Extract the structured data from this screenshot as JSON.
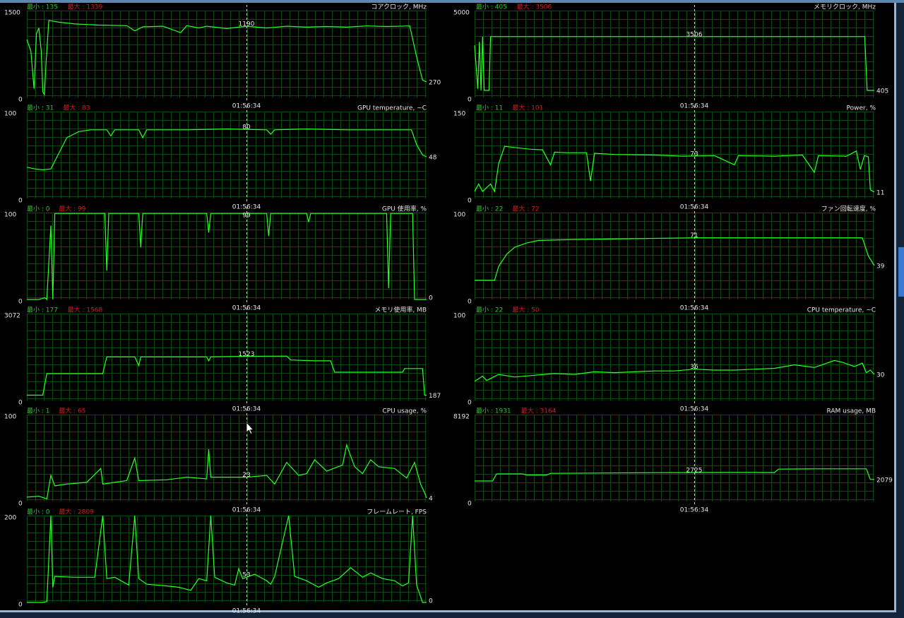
{
  "cursor_time": "01:56:34",
  "legend_min_prefix": "最小 : ",
  "legend_max_prefix": "最大 : ",
  "colors": {
    "min_text": "#2ec32e",
    "max_text": "#cc1f1f",
    "trace": "#2aff2a",
    "grid": "#0e4a0e",
    "cursor": "#e3e35a",
    "background": "#000000"
  },
  "graphs": [
    {
      "id": "core-clock",
      "title": "コアクロック, MHz",
      "min": "135",
      "max": "1339",
      "ymin": 0,
      "ymax": 1500,
      "top_label": "1500",
      "bottom_label": "0",
      "cursor_value": "1190",
      "end_value": "270",
      "points": [
        [
          0.0,
          1000
        ],
        [
          0.01,
          800
        ],
        [
          0.018,
          150
        ],
        [
          0.024,
          1100
        ],
        [
          0.03,
          1200
        ],
        [
          0.036,
          800
        ],
        [
          0.04,
          100
        ],
        [
          0.044,
          50
        ],
        [
          0.048,
          600
        ],
        [
          0.055,
          1330
        ],
        [
          0.08,
          1300
        ],
        [
          0.12,
          1270
        ],
        [
          0.18,
          1250
        ],
        [
          0.25,
          1240
        ],
        [
          0.27,
          1150
        ],
        [
          0.29,
          1220
        ],
        [
          0.34,
          1230
        ],
        [
          0.385,
          1120
        ],
        [
          0.4,
          1240
        ],
        [
          0.43,
          1200
        ],
        [
          0.45,
          1230
        ],
        [
          0.5,
          1190
        ],
        [
          0.55,
          1230
        ],
        [
          0.6,
          1200
        ],
        [
          0.65,
          1230
        ],
        [
          0.7,
          1215
        ],
        [
          0.75,
          1225
        ],
        [
          0.8,
          1215
        ],
        [
          0.85,
          1235
        ],
        [
          0.9,
          1225
        ],
        [
          0.958,
          1235
        ],
        [
          0.975,
          700
        ],
        [
          0.99,
          300
        ],
        [
          1.0,
          270
        ]
      ]
    },
    {
      "id": "memory-clock",
      "title": "メモリクロック, MHz",
      "min": "405",
      "max": "3506",
      "ymin": 0,
      "ymax": 5000,
      "top_label": "5000",
      "bottom_label": "0",
      "cursor_value": "3506",
      "end_value": "405",
      "points": [
        [
          0.0,
          3000
        ],
        [
          0.008,
          500
        ],
        [
          0.012,
          3200
        ],
        [
          0.016,
          400
        ],
        [
          0.02,
          3500
        ],
        [
          0.024,
          405
        ],
        [
          0.036,
          405
        ],
        [
          0.04,
          3506
        ],
        [
          0.976,
          3506
        ],
        [
          0.982,
          405
        ],
        [
          1.0,
          405
        ]
      ]
    },
    {
      "id": "gpu-temperature",
      "title": "GPU temperature, ~C",
      "min": "31",
      "max": "83",
      "ymin": 0,
      "ymax": 100,
      "top_label": "100",
      "bottom_label": "0",
      "cursor_value": "80",
      "end_value": "48",
      "points": [
        [
          0.0,
          36
        ],
        [
          0.02,
          34
        ],
        [
          0.04,
          33
        ],
        [
          0.06,
          34
        ],
        [
          0.08,
          52
        ],
        [
          0.1,
          70
        ],
        [
          0.13,
          77
        ],
        [
          0.16,
          79
        ],
        [
          0.2,
          79
        ],
        [
          0.21,
          72
        ],
        [
          0.22,
          79
        ],
        [
          0.28,
          79
        ],
        [
          0.29,
          70
        ],
        [
          0.3,
          79
        ],
        [
          0.4,
          79
        ],
        [
          0.5,
          80
        ],
        [
          0.6,
          79
        ],
        [
          0.61,
          74
        ],
        [
          0.62,
          79
        ],
        [
          0.7,
          80
        ],
        [
          0.8,
          79
        ],
        [
          0.9,
          79
        ],
        [
          0.962,
          79
        ],
        [
          0.975,
          62
        ],
        [
          0.99,
          50
        ],
        [
          1.0,
          48
        ]
      ]
    },
    {
      "id": "power",
      "title": "Power, %",
      "min": "11",
      "max": "101",
      "ymin": 0,
      "ymax": 150,
      "top_label": "150",
      "bottom_label": "0",
      "cursor_value": "73",
      "end_value": "11",
      "points": [
        [
          0.0,
          12
        ],
        [
          0.01,
          25
        ],
        [
          0.02,
          12
        ],
        [
          0.04,
          25
        ],
        [
          0.05,
          12
        ],
        [
          0.06,
          60
        ],
        [
          0.075,
          90
        ],
        [
          0.1,
          88
        ],
        [
          0.14,
          85
        ],
        [
          0.17,
          84
        ],
        [
          0.19,
          58
        ],
        [
          0.2,
          80
        ],
        [
          0.23,
          79
        ],
        [
          0.28,
          79
        ],
        [
          0.29,
          30
        ],
        [
          0.3,
          78
        ],
        [
          0.35,
          76
        ],
        [
          0.45,
          75
        ],
        [
          0.52,
          73
        ],
        [
          0.6,
          74
        ],
        [
          0.65,
          58
        ],
        [
          0.66,
          74
        ],
        [
          0.75,
          73
        ],
        [
          0.82,
          75
        ],
        [
          0.85,
          45
        ],
        [
          0.86,
          74
        ],
        [
          0.93,
          73
        ],
        [
          0.955,
          82
        ],
        [
          0.965,
          50
        ],
        [
          0.975,
          74
        ],
        [
          0.985,
          72
        ],
        [
          0.99,
          15
        ],
        [
          1.0,
          11
        ]
      ]
    },
    {
      "id": "gpu-usage",
      "title": "GPU 使用率, %",
      "min": "0",
      "max": "99",
      "ymin": 0,
      "ymax": 100,
      "top_label": "100",
      "bottom_label": "0",
      "cursor_value": "99",
      "end_value": "0",
      "points": [
        [
          0.0,
          0
        ],
        [
          0.03,
          0
        ],
        [
          0.045,
          2
        ],
        [
          0.05,
          0
        ],
        [
          0.06,
          85
        ],
        [
          0.065,
          0
        ],
        [
          0.07,
          99
        ],
        [
          0.195,
          99
        ],
        [
          0.2,
          33
        ],
        [
          0.205,
          99
        ],
        [
          0.28,
          99
        ],
        [
          0.285,
          60
        ],
        [
          0.29,
          99
        ],
        [
          0.45,
          99
        ],
        [
          0.455,
          77
        ],
        [
          0.46,
          99
        ],
        [
          0.6,
          99
        ],
        [
          0.605,
          73
        ],
        [
          0.61,
          99
        ],
        [
          0.7,
          99
        ],
        [
          0.705,
          89
        ],
        [
          0.71,
          99
        ],
        [
          0.9,
          99
        ],
        [
          0.905,
          13
        ],
        [
          0.91,
          99
        ],
        [
          0.965,
          99
        ],
        [
          0.97,
          0
        ],
        [
          1.0,
          0
        ]
      ]
    },
    {
      "id": "fan-speed",
      "title": "ファン回転速度, %",
      "min": "22",
      "max": "72",
      "ymin": 0,
      "ymax": 100,
      "top_label": "100",
      "bottom_label": "0",
      "cursor_value": "71",
      "end_value": "39",
      "points": [
        [
          0.0,
          22
        ],
        [
          0.05,
          22
        ],
        [
          0.06,
          38
        ],
        [
          0.08,
          52
        ],
        [
          0.1,
          60
        ],
        [
          0.13,
          65
        ],
        [
          0.16,
          68
        ],
        [
          0.25,
          69
        ],
        [
          0.4,
          70
        ],
        [
          0.55,
          71
        ],
        [
          0.7,
          71
        ],
        [
          0.85,
          71
        ],
        [
          0.97,
          71
        ],
        [
          0.985,
          50
        ],
        [
          1.0,
          39
        ]
      ]
    },
    {
      "id": "memory-usage",
      "title": "メモリ使用率, MB",
      "min": "177",
      "max": "1568",
      "ymin": 0,
      "ymax": 3072,
      "top_label": "3072",
      "bottom_label": "0",
      "cursor_value": "1523",
      "end_value": "187",
      "points": [
        [
          0.0,
          187
        ],
        [
          0.04,
          187
        ],
        [
          0.05,
          950
        ],
        [
          0.19,
          950
        ],
        [
          0.2,
          1540
        ],
        [
          0.27,
          1540
        ],
        [
          0.28,
          1240
        ],
        [
          0.285,
          1540
        ],
        [
          0.45,
          1540
        ],
        [
          0.455,
          1400
        ],
        [
          0.46,
          1540
        ],
        [
          0.55,
          1560
        ],
        [
          0.65,
          1568
        ],
        [
          0.66,
          1430
        ],
        [
          0.72,
          1400
        ],
        [
          0.76,
          1400
        ],
        [
          0.77,
          1000
        ],
        [
          0.94,
          1000
        ],
        [
          0.945,
          1130
        ],
        [
          0.99,
          1130
        ],
        [
          0.995,
          187
        ],
        [
          1.0,
          187
        ]
      ]
    },
    {
      "id": "cpu-temperature",
      "title": "CPU temperature, ~C",
      "min": "22",
      "max": "50",
      "ymin": 0,
      "ymax": 100,
      "top_label": "100",
      "bottom_label": "0",
      "cursor_value": "36",
      "end_value": "30",
      "points": [
        [
          0.0,
          22
        ],
        [
          0.02,
          28
        ],
        [
          0.03,
          23
        ],
        [
          0.06,
          30
        ],
        [
          0.1,
          27
        ],
        [
          0.15,
          29
        ],
        [
          0.2,
          31
        ],
        [
          0.25,
          30
        ],
        [
          0.3,
          33
        ],
        [
          0.35,
          32
        ],
        [
          0.4,
          33
        ],
        [
          0.45,
          34
        ],
        [
          0.5,
          34
        ],
        [
          0.55,
          36
        ],
        [
          0.6,
          35
        ],
        [
          0.65,
          35
        ],
        [
          0.7,
          36
        ],
        [
          0.75,
          37
        ],
        [
          0.8,
          41
        ],
        [
          0.85,
          38
        ],
        [
          0.9,
          46
        ],
        [
          0.92,
          44
        ],
        [
          0.95,
          39
        ],
        [
          0.97,
          43
        ],
        [
          0.98,
          32
        ],
        [
          0.99,
          35
        ],
        [
          1.0,
          30
        ]
      ]
    },
    {
      "id": "cpu-usage",
      "title": "CPU usage, %",
      "min": "1",
      "max": "65",
      "ymin": 0,
      "ymax": 100,
      "top_label": "100",
      "bottom_label": "0",
      "cursor_value": "23",
      "end_value": "4",
      "points": [
        [
          0.0,
          5
        ],
        [
          0.03,
          6
        ],
        [
          0.05,
          3
        ],
        [
          0.06,
          30
        ],
        [
          0.07,
          18
        ],
        [
          0.1,
          20
        ],
        [
          0.15,
          22
        ],
        [
          0.185,
          38
        ],
        [
          0.19,
          20
        ],
        [
          0.25,
          24
        ],
        [
          0.27,
          50
        ],
        [
          0.28,
          24
        ],
        [
          0.35,
          25
        ],
        [
          0.4,
          28
        ],
        [
          0.45,
          26
        ],
        [
          0.455,
          60
        ],
        [
          0.46,
          28
        ],
        [
          0.55,
          28
        ],
        [
          0.6,
          30
        ],
        [
          0.62,
          20
        ],
        [
          0.65,
          45
        ],
        [
          0.68,
          30
        ],
        [
          0.7,
          32
        ],
        [
          0.72,
          48
        ],
        [
          0.75,
          35
        ],
        [
          0.79,
          42
        ],
        [
          0.8,
          65
        ],
        [
          0.82,
          40
        ],
        [
          0.84,
          32
        ],
        [
          0.86,
          48
        ],
        [
          0.88,
          40
        ],
        [
          0.92,
          38
        ],
        [
          0.95,
          27
        ],
        [
          0.97,
          45
        ],
        [
          0.985,
          20
        ],
        [
          0.995,
          10
        ],
        [
          1.0,
          4
        ]
      ]
    },
    {
      "id": "ram-usage",
      "title": "RAM usage, MB",
      "min": "1931",
      "max": "3164",
      "ymin": 0,
      "ymax": 8192,
      "top_label": "8192",
      "bottom_label": "0",
      "cursor_value": "2725",
      "end_value": "2079",
      "points": [
        [
          0.0,
          1931
        ],
        [
          0.045,
          1931
        ],
        [
          0.055,
          2600
        ],
        [
          0.12,
          2600
        ],
        [
          0.13,
          2500
        ],
        [
          0.18,
          2500
        ],
        [
          0.19,
          2650
        ],
        [
          0.3,
          2680
        ],
        [
          0.45,
          2720
        ],
        [
          0.55,
          2725
        ],
        [
          0.7,
          2740
        ],
        [
          0.72,
          2725
        ],
        [
          0.75,
          2725
        ],
        [
          0.76,
          3050
        ],
        [
          0.85,
          3080
        ],
        [
          0.98,
          3080
        ],
        [
          0.99,
          2079
        ],
        [
          1.0,
          2079
        ]
      ]
    },
    {
      "id": "framerate",
      "title": "フレームレート, FPS",
      "min": "0",
      "max": "2809",
      "ymin": 0,
      "ymax": 200,
      "top_label": "200",
      "bottom_label": "0",
      "cursor_value": "53",
      "end_value": "0",
      "points": [
        [
          0.0,
          0
        ],
        [
          0.04,
          0
        ],
        [
          0.05,
          2
        ],
        [
          0.06,
          200
        ],
        [
          0.065,
          35
        ],
        [
          0.07,
          60
        ],
        [
          0.12,
          58
        ],
        [
          0.17,
          58
        ],
        [
          0.19,
          200
        ],
        [
          0.2,
          55
        ],
        [
          0.22,
          58
        ],
        [
          0.255,
          40
        ],
        [
          0.27,
          200
        ],
        [
          0.28,
          55
        ],
        [
          0.3,
          42
        ],
        [
          0.35,
          38
        ],
        [
          0.38,
          35
        ],
        [
          0.41,
          28
        ],
        [
          0.43,
          55
        ],
        [
          0.45,
          50
        ],
        [
          0.46,
          200
        ],
        [
          0.47,
          58
        ],
        [
          0.5,
          45
        ],
        [
          0.52,
          40
        ],
        [
          0.53,
          78
        ],
        [
          0.54,
          55
        ],
        [
          0.57,
          65
        ],
        [
          0.6,
          50
        ],
        [
          0.61,
          42
        ],
        [
          0.62,
          60
        ],
        [
          0.655,
          200
        ],
        [
          0.67,
          60
        ],
        [
          0.7,
          50
        ],
        [
          0.73,
          35
        ],
        [
          0.75,
          45
        ],
        [
          0.78,
          55
        ],
        [
          0.81,
          80
        ],
        [
          0.84,
          58
        ],
        [
          0.86,
          68
        ],
        [
          0.89,
          55
        ],
        [
          0.92,
          50
        ],
        [
          0.94,
          38
        ],
        [
          0.955,
          45
        ],
        [
          0.965,
          200
        ],
        [
          0.975,
          40
        ],
        [
          0.99,
          0
        ],
        [
          1.0,
          0
        ]
      ]
    }
  ]
}
